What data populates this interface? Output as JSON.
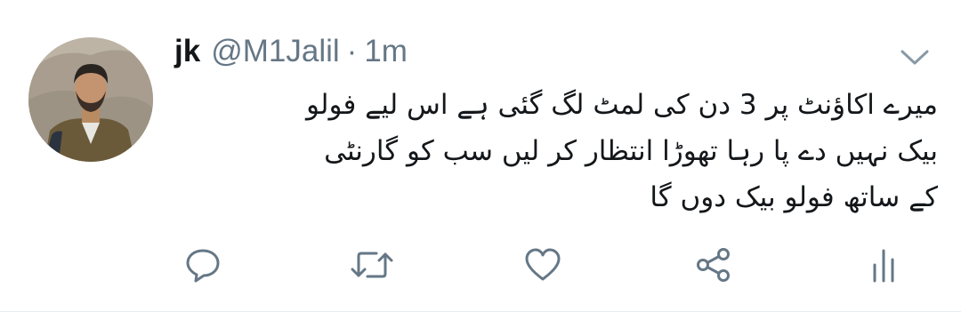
{
  "tweet": {
    "display_name": "jk",
    "handle": "@M1Jalil",
    "separator": "·",
    "timestamp": "1m",
    "lines": [
      "میرے اکاؤنٹ پر 3  دن کی لمٹ لگ گئی ہے اس لیے فولو",
      "بیک نہیں دے پا رہا تھوڑا انتظار کر لیں سب کو گارنٹی",
      "کے ساتھ فولو بیک دوں گا"
    ]
  },
  "icons": {
    "caret": "chevron-down-icon",
    "reply": "reply-icon",
    "retweet": "retweet-icon",
    "like": "heart-icon",
    "share": "share-icon",
    "analytics": "analytics-icon"
  },
  "colors": {
    "text": "#14171a",
    "secondary": "#657786",
    "icon": "#657786"
  }
}
